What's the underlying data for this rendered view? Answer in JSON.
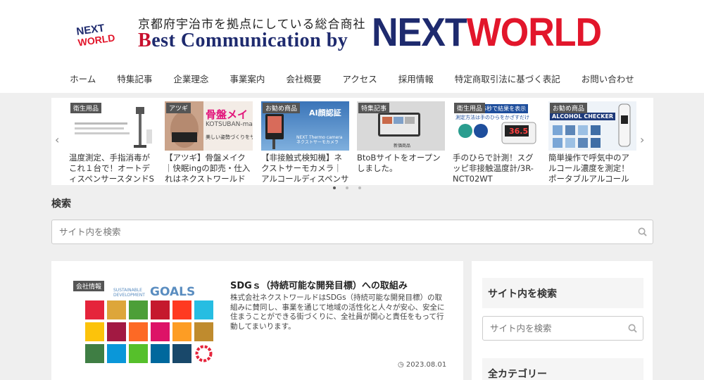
{
  "header": {
    "logo_small": {
      "line1": "NEXT",
      "line2": "WORLD"
    },
    "tagline": "京都府宇治市を拠点にしている総合商社",
    "best_line": {
      "b": "B",
      "rest": "est Communication by"
    },
    "brand": {
      "next": "NEXT",
      "world": "WORLD"
    }
  },
  "nav": {
    "items": [
      "ホーム",
      "特集記事",
      "企業理念",
      "事業案内",
      "会社概要",
      "アクセス",
      "採用情報",
      "特定商取引法に基づく表記",
      "お問い合わせ"
    ]
  },
  "carousel": {
    "cards": [
      {
        "tag": "衛生用品",
        "title": "温度測定、手指消毒がこれ１台で！オートディスペンサースタンドS"
      },
      {
        "tag": "アツギ",
        "title": "【アツギ】骨盤メイク｜快眠ingの卸売・仕入れはネクストワールドへ",
        "thumb_text": "骨盤メイ",
        "thumb_sub": "KOTSUBAN-ma",
        "thumb_note": "美しい姿勢づくりをサポ"
      },
      {
        "tag": "お勧め商品",
        "title": "【非接触式検知機】ネクストサーモカメラ｜アルコールディスペンサー付",
        "thumb_text": "AI顔認証",
        "thumb_sub": "NEXT Thermo camera ネクストサーモカメラ"
      },
      {
        "tag": "特集記事",
        "title": "BtoBサイトをオープンしました。",
        "thumb_sub": "新価商品"
      },
      {
        "tag": "衛生用品",
        "title": "手のひらで計測！スグッピ非接触温度計/3R-NCT02WT",
        "thumb_text": "5秒で結果を表示",
        "thumb_sub": "測定方法は手のひらをかざすだけ",
        "thumb_reading": "36.5"
      },
      {
        "tag": "お勧め商品",
        "title": "簡単操作で呼気中のアルコール濃度を測定！ポータブルアルコールチェ…",
        "thumb_text": "ALCOHOL CHECKER"
      }
    ],
    "arrows": {
      "left": "‹",
      "right": "›"
    }
  },
  "search": {
    "heading": "検索",
    "placeholder": "サイト内を検索"
  },
  "article": {
    "tag": "会社情報",
    "title": "SDGｓ（持続可能な開発目標）への取組み",
    "excerpt": "株式会社ネクストワールドはSDGs（持続可能な開発目標）の取組みに賛同し、事業を通じて地域の活性化と人々が安心、安全に住まうことができる街づくりに、全社員が関心と責任をもって行動してまいります。",
    "date": "2023.08.01",
    "sdg_heading_1": "SUSTAINABLE",
    "sdg_heading_2": "DEVELOPMENT",
    "sdg_goals": "GOALS",
    "sdg_colors": [
      "#e5243b",
      "#dda63a",
      "#4c9f38",
      "#c5192d",
      "#ff3a21",
      "#26bde2",
      "#fcc30b",
      "#a21942",
      "#fd6925",
      "#dd1367",
      "#fd9d24",
      "#bf8b2e",
      "#3f7e44",
      "#0a97d9",
      "#56c02b",
      "#00689d",
      "#19486a"
    ]
  },
  "sidebar": {
    "search_title": "サイト内を検索",
    "search_placeholder": "サイト内を検索",
    "category_title": "全カテゴリー"
  }
}
